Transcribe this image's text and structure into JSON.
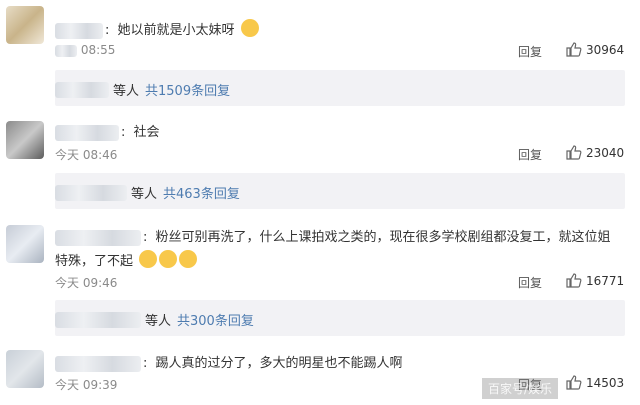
{
  "comments": [
    {
      "text": "她以前就是小太妹呀",
      "time": "08:55",
      "reply_label": "回复",
      "likes": "30964",
      "sub": {
        "suffix": "等人",
        "link": "共1509条回复"
      }
    },
    {
      "text": "社会",
      "time": "今天 08:46",
      "reply_label": "回复",
      "likes": "23040",
      "sub": {
        "suffix": "等人",
        "link": "共463条回复"
      }
    },
    {
      "text_line1": "粉丝可别再洗了，什么上课拍戏之类的，现在很多学校剧组都没复工，就这位姐",
      "text_line2": "特殊，了不起",
      "time": "今天 09:46",
      "reply_label": "回复",
      "likes": "16771",
      "sub": {
        "suffix": "等人",
        "link": "共300条回复"
      }
    },
    {
      "text": "踢人真的过分了，多大的明星也不能踢人啊",
      "time": "今天 09:39",
      "reply_label": "回复",
      "likes": "14503"
    }
  ],
  "watermark": "百家号/娱乐",
  "icons": {
    "like": "thumbs-up-icon",
    "emoji": "face-emoji-icon"
  },
  "colors": {
    "link": "#4e7cb0",
    "subbar_bg": "#f2f2f5"
  }
}
